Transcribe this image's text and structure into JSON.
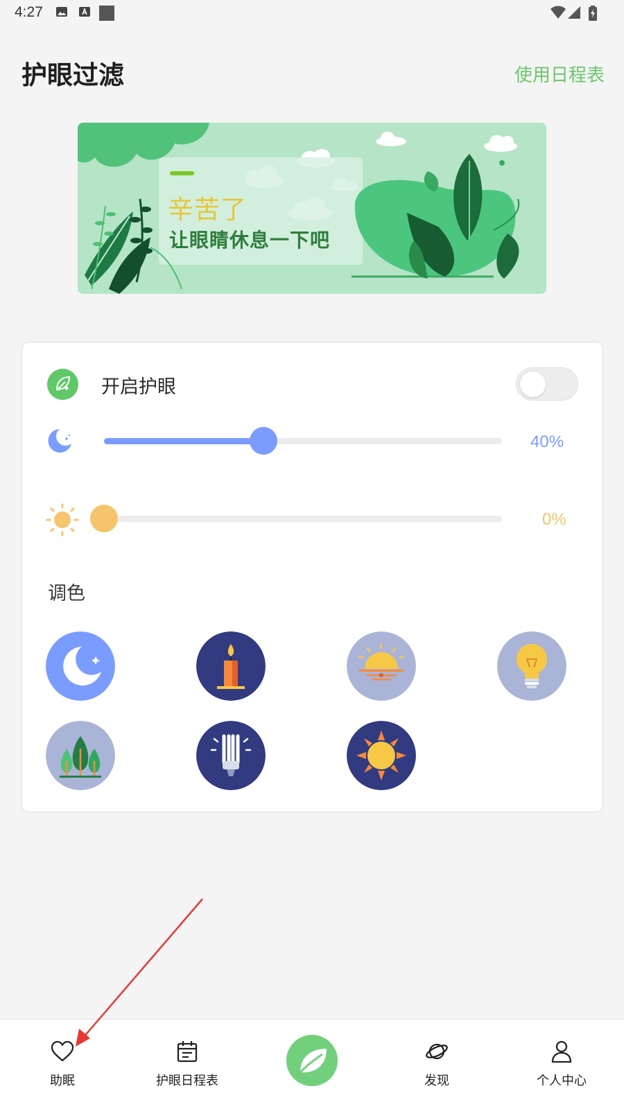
{
  "status_bar": {
    "time": "4:27"
  },
  "header": {
    "title": "护眼过滤",
    "schedule_link": "使用日程表"
  },
  "banner": {
    "line1": "辛苦了",
    "line2": "让眼睛休息一下吧"
  },
  "card": {
    "eye_care_label": "开启护眼",
    "eye_care_enabled": false,
    "filter_slider": {
      "value": 40,
      "display": "40%",
      "color": "#7b9cff"
    },
    "brightness_slider": {
      "value": 0,
      "display": "0%",
      "color": "#f5c56e"
    },
    "color_section_label": "调色",
    "color_presets": [
      {
        "icon": "moon-icon"
      },
      {
        "icon": "candle-icon"
      },
      {
        "icon": "sunrise-icon"
      },
      {
        "icon": "lightbulb-icon"
      },
      {
        "icon": "forest-icon"
      },
      {
        "icon": "fluorescent-lamp-icon"
      },
      {
        "icon": "sun-icon"
      }
    ]
  },
  "bottom_nav": {
    "items": [
      {
        "label": "助眠",
        "icon": "heart-icon"
      },
      {
        "label": "护眼日程表",
        "icon": "calendar-icon"
      },
      {
        "label": "",
        "icon": "leaf-icon"
      },
      {
        "label": "发现",
        "icon": "planet-icon"
      },
      {
        "label": "个人中心",
        "icon": "person-icon"
      }
    ]
  },
  "colors": {
    "accent_green": "#6cc66c",
    "slider_blue": "#7b9cff",
    "slider_yellow": "#f5c56e",
    "annotation_arrow": "#e53935"
  }
}
